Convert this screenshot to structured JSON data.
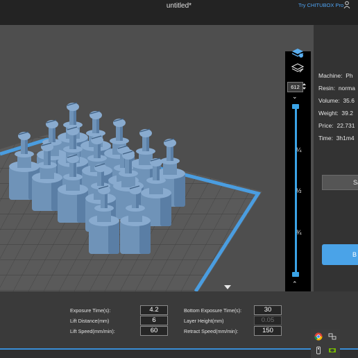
{
  "window": {
    "title": "untitled*",
    "try_link": "Try CHITUBOX Pro"
  },
  "slider": {
    "layer_value": "612",
    "fractions": [
      "¼",
      "½",
      "¾"
    ]
  },
  "info": [
    {
      "label": "Machine:",
      "value": "Ph"
    },
    {
      "label": "Resin:",
      "value": "norma"
    },
    {
      "label": "Volume:",
      "value": "35.6"
    },
    {
      "label": "Weight:",
      "value": "39.2"
    },
    {
      "label": "Price:",
      "value": "22.731"
    },
    {
      "label": "Time:",
      "value": "3h1m4"
    }
  ],
  "buttons": {
    "save_label": "Sa",
    "blue_label": "B"
  },
  "params": {
    "exposure_time": {
      "label": "Exposure Time(s):",
      "value": "4.2"
    },
    "bottom_exposure_time": {
      "label": "Bottom Exposure Time(s):",
      "value": "30"
    },
    "lift_distance": {
      "label": "Lift Distance(mm)",
      "value": "6"
    },
    "layer_height": {
      "label": "Layer Height(mm)",
      "value": "0.05"
    },
    "lift_speed": {
      "label": "Lift Speed(mm/min):",
      "value": "60"
    },
    "retract_speed": {
      "label": "Retract Speed(mm/min):",
      "value": "150"
    }
  },
  "colors": {
    "accent": "#3aa3e6",
    "model": "#6f93b8",
    "platform_border": "#4a9de0"
  },
  "icons": [
    "layers-icon",
    "layers-hide-icon",
    "user-icon",
    "collapse-arrow-icon",
    "chrome-icon",
    "nvidia-icon",
    "usb-icon",
    "network-icon"
  ]
}
